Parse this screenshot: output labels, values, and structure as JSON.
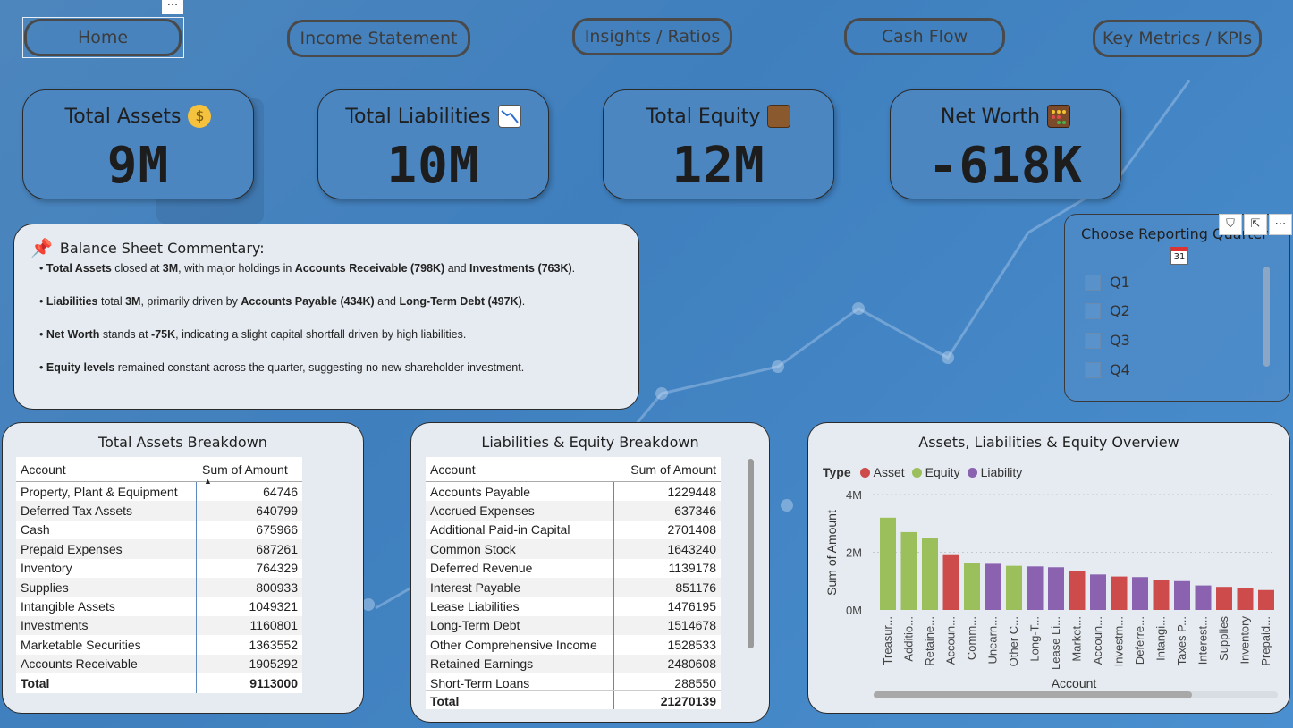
{
  "nav": {
    "home": "Home",
    "income": "Income Statement",
    "insights": "Insights / Ratios",
    "cashflow": "Cash Flow",
    "kpis": "Key Metrics / KPIs",
    "more": "···"
  },
  "kpis": {
    "assets": {
      "title": "Total Assets",
      "value": "9M",
      "icon": "money-bag-icon"
    },
    "liabilities": {
      "title": "Total Liabilities",
      "value": "10M",
      "icon": "chart-decreasing-icon"
    },
    "equity": {
      "title": "Total Equity",
      "value": "12M",
      "icon": "briefcase-icon"
    },
    "networth": {
      "title": "Net Worth",
      "value": "-618K",
      "icon": "abacus-icon"
    }
  },
  "commentary": {
    "title": "Balance Sheet Commentary:",
    "icon": "pushpin-icon",
    "l1": {
      "b1": "Total Assets",
      "t1": " closed at ",
      "b2": "3M",
      "t2": ", with major holdings in ",
      "b3": "Accounts Receivable (798K)",
      "t3": " and ",
      "b4": "Investments (763K)",
      "t4": "."
    },
    "l2": {
      "b1": "Liabilities",
      "t1": " total ",
      "b2": "3M",
      "t2": ", primarily driven by ",
      "b3": "Accounts Payable (434K)",
      "t3": " and ",
      "b4": "Long-Term Debt (497K)",
      "t4": "."
    },
    "l3": {
      "b1": "Net Worth",
      "t1": " stands at ",
      "b2": "-75K",
      "t2": ", indicating a slight capital shortfall driven by high liabilities."
    },
    "l4": {
      "b1": "Equity levels",
      "t1": " remained constant across the quarter, suggesting no new shareholder investment."
    }
  },
  "slicer": {
    "title": "Choose Reporting Quarter",
    "cal": "31",
    "options": [
      "Q1",
      "Q2",
      "Q3",
      "Q4"
    ]
  },
  "assets_table": {
    "title": "Total Assets Breakdown",
    "headers": [
      "Account",
      "Sum of Amount"
    ],
    "rows": [
      [
        "Property, Plant & Equipment",
        "64746"
      ],
      [
        "Deferred Tax Assets",
        "640799"
      ],
      [
        "Cash",
        "675966"
      ],
      [
        "Prepaid Expenses",
        "687261"
      ],
      [
        "Inventory",
        "764329"
      ],
      [
        "Supplies",
        "800933"
      ],
      [
        "Intangible Assets",
        "1049321"
      ],
      [
        "Investments",
        "1160801"
      ],
      [
        "Marketable Securities",
        "1363552"
      ],
      [
        "Accounts Receivable",
        "1905292"
      ]
    ],
    "total_label": "Total",
    "total_value": "9113000"
  },
  "le_table": {
    "title": "Liabilities & Equity Breakdown",
    "headers": [
      "Account",
      "Sum of Amount"
    ],
    "rows": [
      [
        "Accounts Payable",
        "1229448"
      ],
      [
        "Accrued Expenses",
        "637346"
      ],
      [
        "Additional Paid-in Capital",
        "2701408"
      ],
      [
        "Common Stock",
        "1643240"
      ],
      [
        "Deferred Revenue",
        "1139178"
      ],
      [
        "Interest Payable",
        "851176"
      ],
      [
        "Lease Liabilities",
        "1476195"
      ],
      [
        "Long-Term Debt",
        "1514678"
      ],
      [
        "Other Comprehensive Income",
        "1528533"
      ],
      [
        "Retained Earnings",
        "2480608"
      ],
      [
        "Short-Term Loans",
        "288550"
      ]
    ],
    "total_label": "Total",
    "total_value": "21270139"
  },
  "chart_data": {
    "type": "bar",
    "title": "Assets, Liabilities & Equity Overview",
    "legend_title": "Type",
    "legend": [
      {
        "name": "Asset",
        "color": "#cd4b4b"
      },
      {
        "name": "Equity",
        "color": "#9bbf5a"
      },
      {
        "name": "Liability",
        "color": "#8a62b0"
      }
    ],
    "xlabel": "Account",
    "ylabel": "Sum of Amount",
    "ylim": [
      0,
      4000000
    ],
    "yticks": [
      "0M",
      "2M",
      "4M"
    ],
    "categories": [
      "Treasur...",
      "Additio...",
      "Retaine...",
      "Accoun...",
      "Comm...",
      "Unearn...",
      "Other C...",
      "Long-T...",
      "Lease Li...",
      "Market...",
      "Accoun...",
      "Investm...",
      "Deferre...",
      "Intangi...",
      "Taxes P...",
      "Interest...",
      "Supplies",
      "Inventory",
      "Prepaid..."
    ],
    "types": [
      "Equity",
      "Equity",
      "Equity",
      "Asset",
      "Equity",
      "Liability",
      "Equity",
      "Liability",
      "Liability",
      "Asset",
      "Liability",
      "Asset",
      "Liability",
      "Asset",
      "Liability",
      "Liability",
      "Asset",
      "Asset",
      "Asset"
    ],
    "values": [
      3200000,
      2700000,
      2480000,
      1900000,
      1640000,
      1600000,
      1530000,
      1510000,
      1480000,
      1360000,
      1230000,
      1160000,
      1140000,
      1050000,
      1000000,
      850000,
      800000,
      760000,
      690000
    ]
  }
}
